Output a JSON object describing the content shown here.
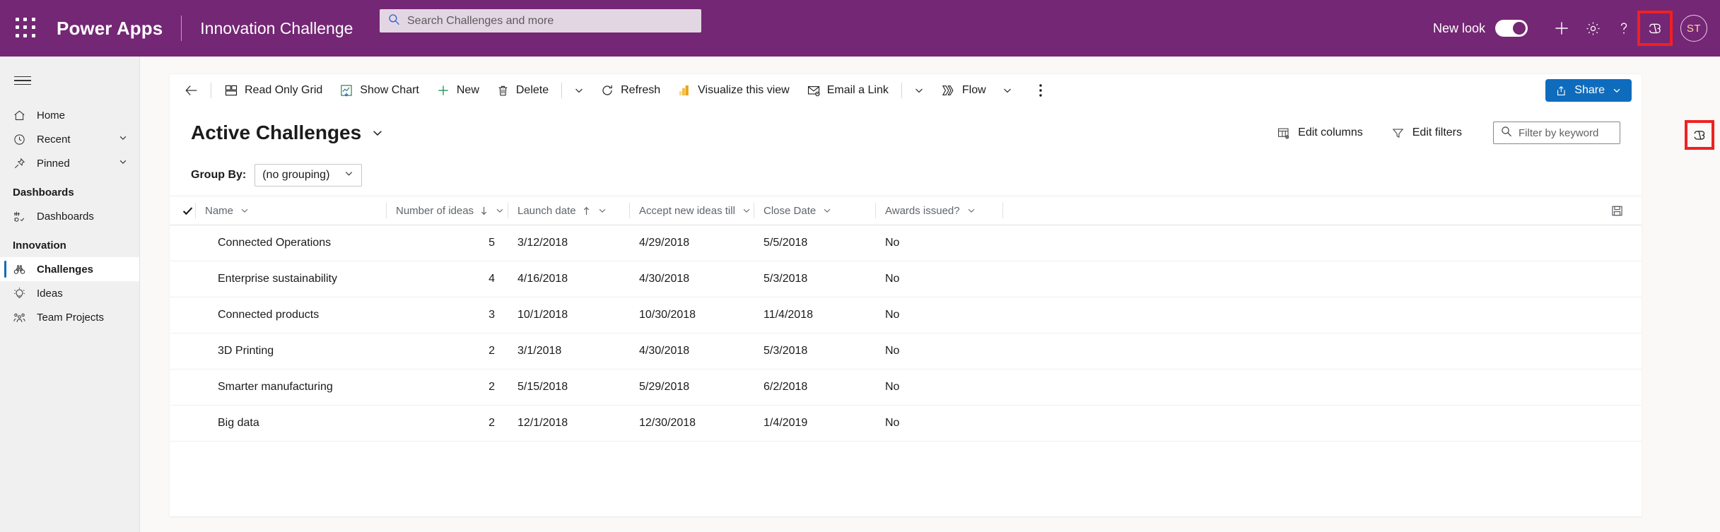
{
  "header": {
    "waffle_icon": "waffle-grid-icon",
    "brand": "Power Apps",
    "app_name": "Innovation Challenge",
    "search": {
      "placeholder": "Search Challenges and more",
      "value": "",
      "icon": "search-icon"
    },
    "new_look_label": "New look",
    "new_look_on": true,
    "actions": [
      {
        "name": "add-icon",
        "glyph": "plus"
      },
      {
        "name": "settings-gear-icon",
        "glyph": "gear"
      },
      {
        "name": "help-icon",
        "glyph": "question"
      },
      {
        "name": "copilot-icon",
        "glyph": "copilot",
        "highlighted": true
      }
    ],
    "avatar_initials": "ST",
    "highlight_color": "#f02020",
    "bar_color": "#742774"
  },
  "sidebar": {
    "hamburger_label": "hamburger-menu",
    "items": [
      {
        "label": "Home",
        "icon": "home-icon",
        "has_chevron": false,
        "selected": false
      },
      {
        "label": "Recent",
        "icon": "clock-icon",
        "has_chevron": true,
        "selected": false
      },
      {
        "label": "Pinned",
        "icon": "pin-icon",
        "has_chevron": true,
        "selected": false
      }
    ],
    "groups": [
      {
        "title": "Dashboards",
        "items": [
          {
            "label": "Dashboards",
            "icon": "dashboard-icon",
            "selected": false
          }
        ]
      },
      {
        "title": "Innovation",
        "items": [
          {
            "label": "Challenges",
            "icon": "binoculars-icon",
            "selected": true
          },
          {
            "label": "Ideas",
            "icon": "lightbulb-icon",
            "selected": false
          },
          {
            "label": "Team Projects",
            "icon": "people-group-icon",
            "selected": false
          }
        ]
      }
    ],
    "accent_color": "#0f6cbd"
  },
  "commandbar": {
    "back_label": "back-arrow",
    "commands": [
      {
        "label": "Read Only Grid",
        "icon": "grid-icon"
      },
      {
        "label": "Show Chart",
        "icon": "chart-icon"
      },
      {
        "label": "New",
        "icon": "plus-icon"
      },
      {
        "label": "Delete",
        "icon": "trash-icon"
      },
      {
        "label": "Refresh",
        "icon": "refresh-icon"
      },
      {
        "label": "Visualize this view",
        "icon": "powerbi-icon"
      },
      {
        "label": "Email a Link",
        "icon": "email-icon"
      },
      {
        "label": "Flow",
        "icon": "flow-icon"
      }
    ],
    "overflow_label": "more-commands",
    "share": {
      "label": "Share",
      "icon": "share-icon",
      "color": "#0f6cbd"
    },
    "copilot_panel_icon": "copilot-icon"
  },
  "view": {
    "title": "Active Challenges",
    "edit_columns_label": "Edit columns",
    "edit_filters_label": "Edit filters",
    "keyword_filter": {
      "placeholder": "Filter by keyword",
      "value": ""
    },
    "group_by_label": "Group By:",
    "group_by_value": "(no grouping)"
  },
  "grid": {
    "columns": [
      {
        "key": "name",
        "label": "Name",
        "sort": ""
      },
      {
        "key": "ideas",
        "label": "Number of ideas",
        "sort": "desc"
      },
      {
        "key": "launch",
        "label": "Launch date",
        "sort": "asc"
      },
      {
        "key": "accept",
        "label": "Accept new ideas till",
        "sort": ""
      },
      {
        "key": "close",
        "label": "Close Date",
        "sort": ""
      },
      {
        "key": "awards",
        "label": "Awards issued?",
        "sort": ""
      }
    ],
    "save_icon": "save-icon",
    "rows": [
      {
        "name": "Connected Operations",
        "ideas": "5",
        "launch": "3/12/2018",
        "accept": "4/29/2018",
        "close": "5/5/2018",
        "awards": "No"
      },
      {
        "name": "Enterprise sustainability",
        "ideas": "4",
        "launch": "4/16/2018",
        "accept": "4/30/2018",
        "close": "5/3/2018",
        "awards": "No"
      },
      {
        "name": "Connected products",
        "ideas": "3",
        "launch": "10/1/2018",
        "accept": "10/30/2018",
        "close": "11/4/2018",
        "awards": "No"
      },
      {
        "name": "3D Printing",
        "ideas": "2",
        "launch": "3/1/2018",
        "accept": "4/30/2018",
        "close": "5/3/2018",
        "awards": "No"
      },
      {
        "name": "Smarter manufacturing",
        "ideas": "2",
        "launch": "5/15/2018",
        "accept": "5/29/2018",
        "close": "6/2/2018",
        "awards": "No"
      },
      {
        "name": "Big data",
        "ideas": "2",
        "launch": "12/1/2018",
        "accept": "12/30/2018",
        "close": "1/4/2019",
        "awards": "No"
      }
    ]
  }
}
